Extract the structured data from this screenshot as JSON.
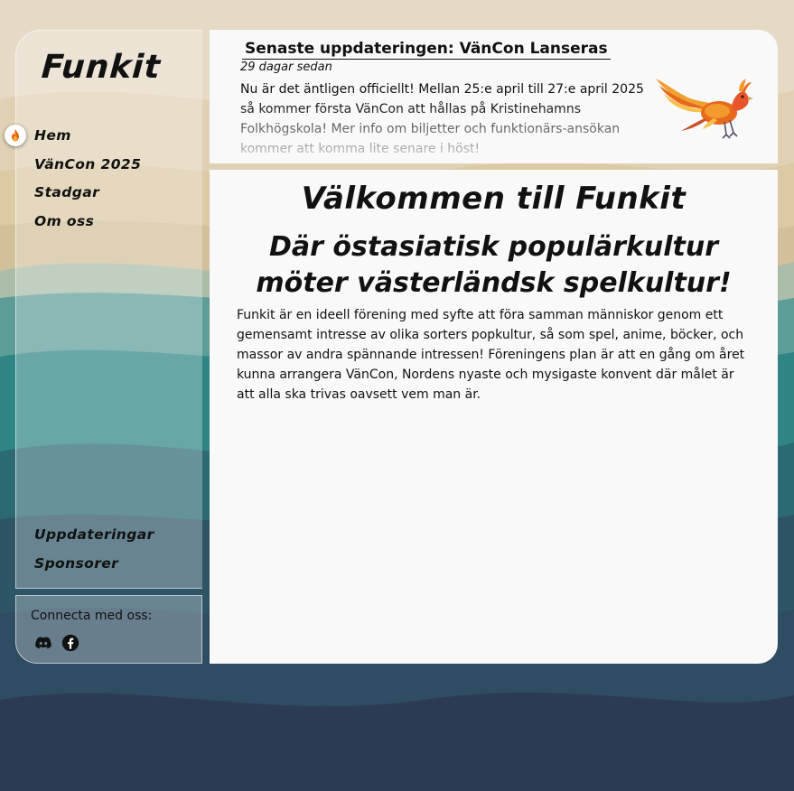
{
  "site": {
    "logo": "Funkit"
  },
  "sidebar": {
    "nav_top": [
      {
        "label": "Hem",
        "active": true
      },
      {
        "label": "VänCon 2025"
      },
      {
        "label": "Stadgar"
      },
      {
        "label": "Om oss"
      }
    ],
    "nav_bottom": [
      {
        "label": "Uppdateringar"
      },
      {
        "label": "Sponsorer"
      }
    ],
    "active_icon": "flame-icon"
  },
  "social": {
    "label": "Connecta med oss:",
    "icons": [
      "discord-icon",
      "facebook-icon"
    ]
  },
  "news": {
    "title": "Senaste uppdateringen: VänCon Lanseras",
    "date": "29 dagar sedan",
    "text": "Nu är det äntligen officiellt! Mellan 25:e april till 27:e april 2025 så kommer första VänCon att hållas på Kristinehamns Folkhögskola! Mer info om biljetter och funktionärs-ansökan kommer att komma lite senare i höst!",
    "image": "phoenix-illustration"
  },
  "main": {
    "heading": "Välkommen till Funkit",
    "subheading": "Där östasiatisk populärkultur möter västerländsk spelkultur!",
    "body": "Funkit är en ideell förening med syfte att föra samman människor genom ett gemensamt intresse av olika sorters popkultur, så som spel, anime, böcker, och massor av andra spännande intressen! Föreningens plan är att en gång om året kunna arrangera VänCon, Nordens nyaste och mysigaste konvent där målet är att alla ska trivas oavsett vem man är."
  },
  "colors": {
    "sand": "#e4d6bf",
    "teal": "#2d7f82",
    "navy": "#2e3a52",
    "panel": "#f9f9f9",
    "accent": "#e8691c"
  }
}
